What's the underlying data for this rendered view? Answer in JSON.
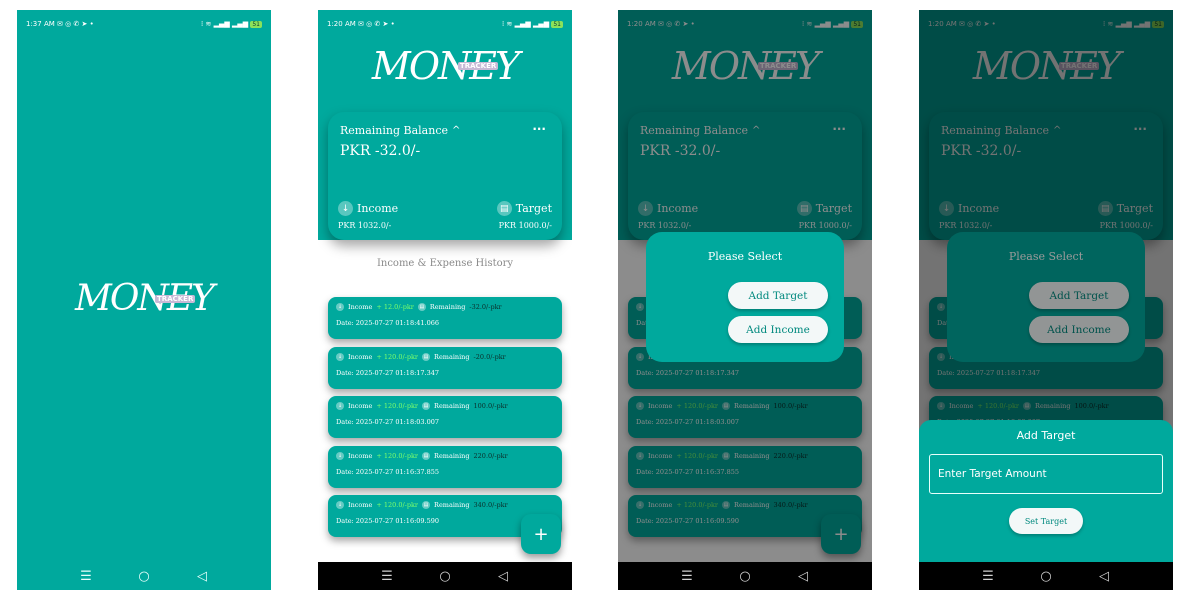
{
  "status": {
    "p1": {
      "time": "1:37 AM",
      "icons": "✉ ◎ ✆ ➤ •",
      "right": "⁞ ≋ ▂▄▆ ▂▄▆",
      "battery": "51"
    },
    "p2": {
      "time": "1:20 AM",
      "icons": "✉ ◎ ✆ ➤ •",
      "right": "⁞ ≋ ▂▄▆ ▂▄▆",
      "battery": "51"
    },
    "p3": {
      "time": "1:20 AM",
      "icons": "✉ ◎ ✆ ➤ •",
      "right": "⁞ ≋ ▂▄▆ ▂▄▆",
      "battery": "51"
    },
    "p4": {
      "time": "1:20 AM",
      "icons": "✉ ◎ ✆ ➤ •",
      "right": "⁞ ≋ ▂▄▆ ▂▄▆",
      "battery": "51"
    }
  },
  "logo": {
    "word": "MONEY",
    "tag": "TRACKER"
  },
  "balance": {
    "title": "Remaining Balance",
    "chevron": "^",
    "more": "···",
    "amount": "PKR -32.0/-",
    "income_label": "Income",
    "income_value": "PKR 1032.0/-",
    "target_label": "Target",
    "target_value": "PKR 1000.0/-",
    "income_icon": "↓",
    "target_icon": "▤"
  },
  "history": {
    "title": "Income & Expense History",
    "items": [
      {
        "income_label": "Income",
        "income": "+ 12.0/-pkr",
        "remaining_label": "Remaining",
        "remaining": "-32.0/-pkr",
        "date": "Date: 2025-07-27 01:18:41.066"
      },
      {
        "income_label": "Income",
        "income": "+ 120.0/-pkr",
        "remaining_label": "Remaining",
        "remaining": "-20.0/-pkr",
        "date": "Date: 2025-07-27 01:18:17.347"
      },
      {
        "income_label": "Income",
        "income": "+ 120.0/-pkr",
        "remaining_label": "Remaining",
        "remaining": "100.0/-pkr",
        "date": "Date: 2025-07-27 01:18:03.007"
      },
      {
        "income_label": "Income",
        "income": "+ 120.0/-pkr",
        "remaining_label": "Remaining",
        "remaining": "220.0/-pkr",
        "date": "Date: 2025-07-27 01:16:37.855"
      },
      {
        "income_label": "Income",
        "income": "+ 120.0/-pkr",
        "remaining_label": "Remaining",
        "remaining": "340.0/-pkr",
        "date": "Date: 2025-07-27 01:16:09.590"
      }
    ]
  },
  "fab": {
    "label": "+"
  },
  "dialog": {
    "title": "Please Select",
    "add_target": "Add Target",
    "add_income": "Add Income"
  },
  "sheet": {
    "title": "Add Target",
    "placeholder": "Enter Target Amount",
    "button": "Set Target"
  },
  "nav": {
    "menu": "☰",
    "home": "○",
    "back": "◁"
  },
  "colors": {
    "primary": "#00A99D",
    "button_bg": "#F3F8F8",
    "button_text": "#00897E",
    "income_green": "#7CFF6B"
  }
}
